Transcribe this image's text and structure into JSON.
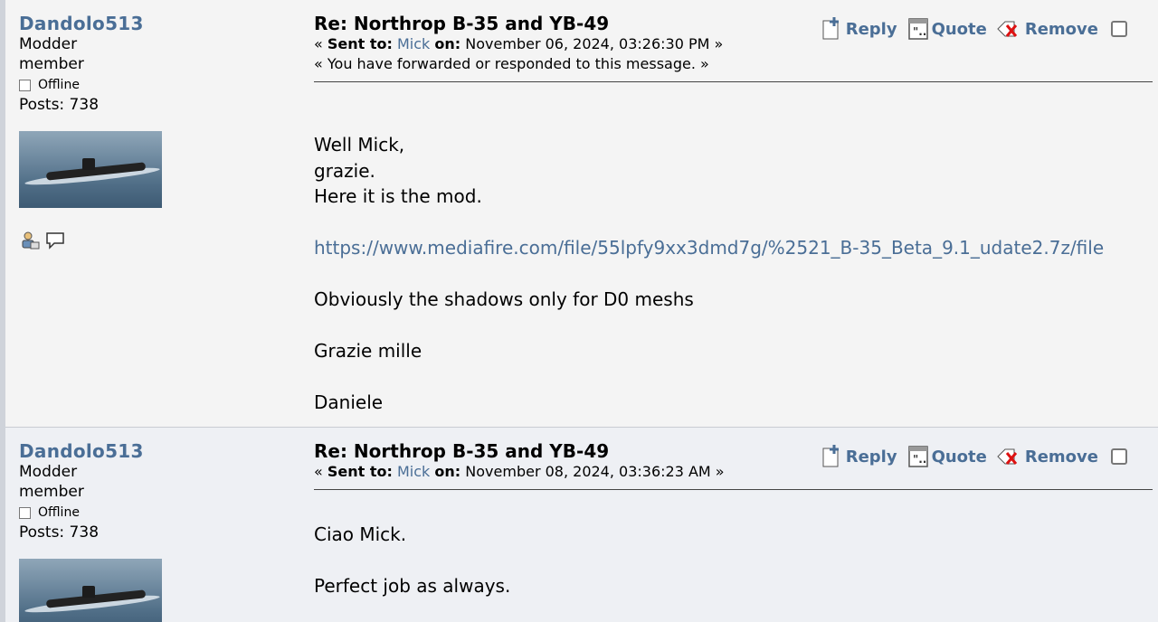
{
  "posts": [
    {
      "poster": {
        "name": "Dandolo513",
        "group_line1": "Modder",
        "group_line2": "member",
        "status": "Offline",
        "posts": "Posts: 738"
      },
      "subject": "Re: Northrop B-35 and YB-49",
      "meta": {
        "prefix": "« ",
        "sent_to_label": "Sent to:",
        "sent_to": "Mick",
        "on_label": "on:",
        "date": "November 06, 2024, 03:26:30 PM",
        "suffix": " »",
        "forward_note": "« You have forwarded or responded to this message. »"
      },
      "actions": {
        "reply": "Reply",
        "quote": "Quote",
        "remove": "Remove"
      },
      "body": [
        "Well Mick,",
        "grazie.",
        "Here it is the mod.",
        "",
        "https://www.mediafire.com/file/55lpfy9xx3dmd7g/%2521_B-35_Beta_9.1_udate2.7z/file",
        "",
        "Obviously the shadows only for D0 meshs",
        "",
        "Grazie mille",
        "",
        "Daniele"
      ]
    },
    {
      "poster": {
        "name": "Dandolo513",
        "group_line1": "Modder",
        "group_line2": "member",
        "status": "Offline",
        "posts": "Posts: 738"
      },
      "subject": "Re: Northrop B-35 and YB-49",
      "meta": {
        "prefix": "« ",
        "sent_to_label": "Sent to:",
        "sent_to": "Mick",
        "on_label": "on:",
        "date": "November 08, 2024, 03:36:23 AM",
        "suffix": " »"
      },
      "actions": {
        "reply": "Reply",
        "quote": "Quote",
        "remove": "Remove"
      },
      "body": [
        "Ciao Mick.",
        "",
        "Perfect job as always."
      ]
    }
  ],
  "colors": {
    "link": "#4a6e96",
    "background": "#f4f4f4",
    "alt_background": "#eef0f4"
  }
}
